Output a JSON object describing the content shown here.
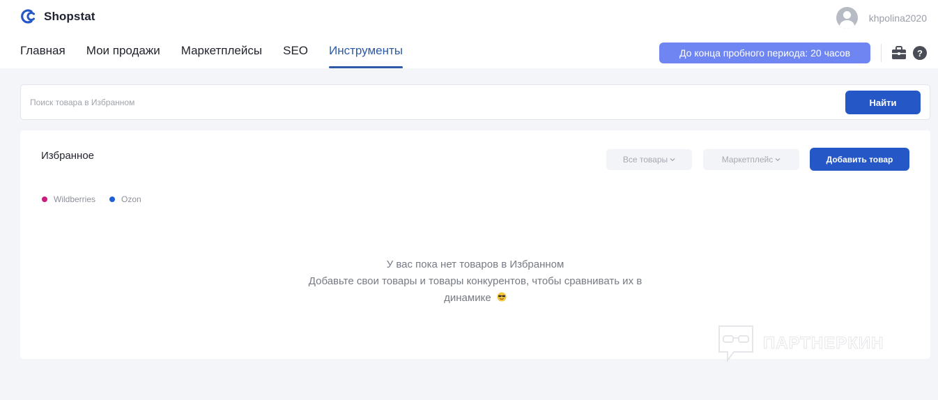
{
  "header": {
    "brand_name": "Shopstat",
    "username": "khpolina2020",
    "trial_badge": "До конца пробного периода: 20 часов",
    "icons": {
      "logo": "shopstat-logo-icon",
      "avatar": "user-avatar-icon",
      "briefcase": "briefcase-icon",
      "help": "help-icon"
    },
    "help_symbol": "?"
  },
  "nav": {
    "items": [
      {
        "label": "Главная"
      },
      {
        "label": "Мои продажи"
      },
      {
        "label": "Маркетплейсы"
      },
      {
        "label": "SEO"
      },
      {
        "label": "Инструменты"
      }
    ],
    "active_index": 4
  },
  "search": {
    "placeholder": "Поиск товара в Избранном",
    "value": "",
    "button_label": "Найти"
  },
  "favorites": {
    "title": "Избранное",
    "filter_products": "Все товары",
    "filter_marketplace": "Маркетплейс",
    "add_button": "Добавить товар",
    "legend": [
      {
        "label": "Wildberries",
        "color": "#cb1b7c"
      },
      {
        "label": "Ozon",
        "color": "#1f5fd6"
      }
    ],
    "empty_line1": "У вас пока нет товаров в Избранном",
    "empty_line2": "Добавьте свои товары и товары конкурентов, чтобы сравнивать их в",
    "empty_line3": "динамике"
  },
  "watermark": {
    "text": "ПАРТНЕРКИН"
  },
  "colors": {
    "accent": "#2557c7",
    "nav_active": "#2c5aa6",
    "trial_badge": "#6f86f2",
    "page_background": "#f4f5f9"
  }
}
